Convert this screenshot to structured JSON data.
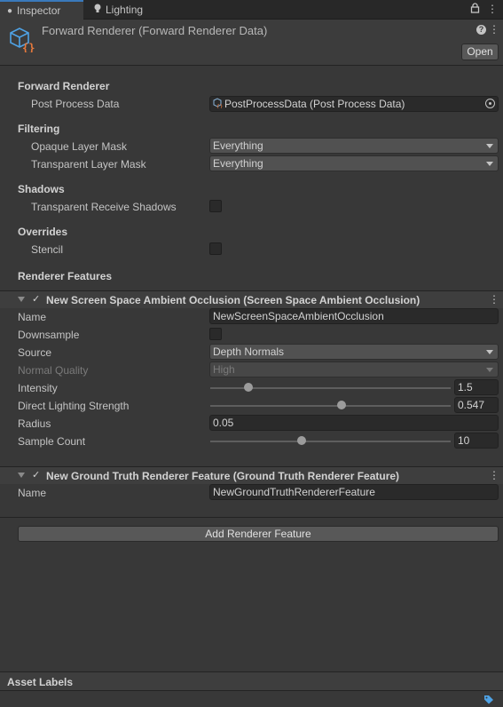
{
  "tabs": [
    {
      "label": "Inspector",
      "icon": "info-icon",
      "active": true
    },
    {
      "label": "Lighting",
      "icon": "lightbulb-icon",
      "active": false
    }
  ],
  "header": {
    "title": "Forward Renderer (Forward Renderer Data)",
    "open_label": "Open",
    "help_glyph": "?"
  },
  "forward_renderer": {
    "title": "Forward Renderer",
    "post_process_label": "Post Process Data",
    "post_process_value": "PostProcessData (Post Process Data)"
  },
  "filtering": {
    "title": "Filtering",
    "opaque_label": "Opaque Layer Mask",
    "opaque_value": "Everything",
    "transparent_label": "Transparent Layer Mask",
    "transparent_value": "Everything"
  },
  "shadows": {
    "title": "Shadows",
    "receive_label": "Transparent Receive Shadows",
    "receive_checked": false
  },
  "overrides": {
    "title": "Overrides",
    "stencil_label": "Stencil",
    "stencil_checked": false
  },
  "renderer_features_title": "Renderer Features",
  "ssao": {
    "title": "New Screen Space Ambient Occlusion (Screen Space Ambient Occlusion)",
    "enabled": true,
    "name_label": "Name",
    "name_value": "NewScreenSpaceAmbientOcclusion",
    "downsample_label": "Downsample",
    "downsample_checked": false,
    "source_label": "Source",
    "source_value": "Depth Normals",
    "normal_quality_label": "Normal Quality",
    "normal_quality_value": "High",
    "intensity_label": "Intensity",
    "intensity_value": "1.5",
    "intensity_fraction": 0.16,
    "direct_label": "Direct Lighting Strength",
    "direct_value": "0.547",
    "direct_fraction": 0.547,
    "radius_label": "Radius",
    "radius_value": "0.05",
    "sample_label": "Sample Count",
    "sample_value": "10",
    "sample_fraction": 0.38
  },
  "ground_truth": {
    "title": "New Ground Truth Renderer Feature (Ground Truth Renderer Feature)",
    "enabled": true,
    "name_label": "Name",
    "name_value": "NewGroundTruthRendererFeature"
  },
  "add_feature_label": "Add Renderer Feature",
  "asset_labels_title": "Asset Labels",
  "colors": {
    "accent": "#3a79bb",
    "background": "#383838",
    "field": "#2a2a2a"
  }
}
